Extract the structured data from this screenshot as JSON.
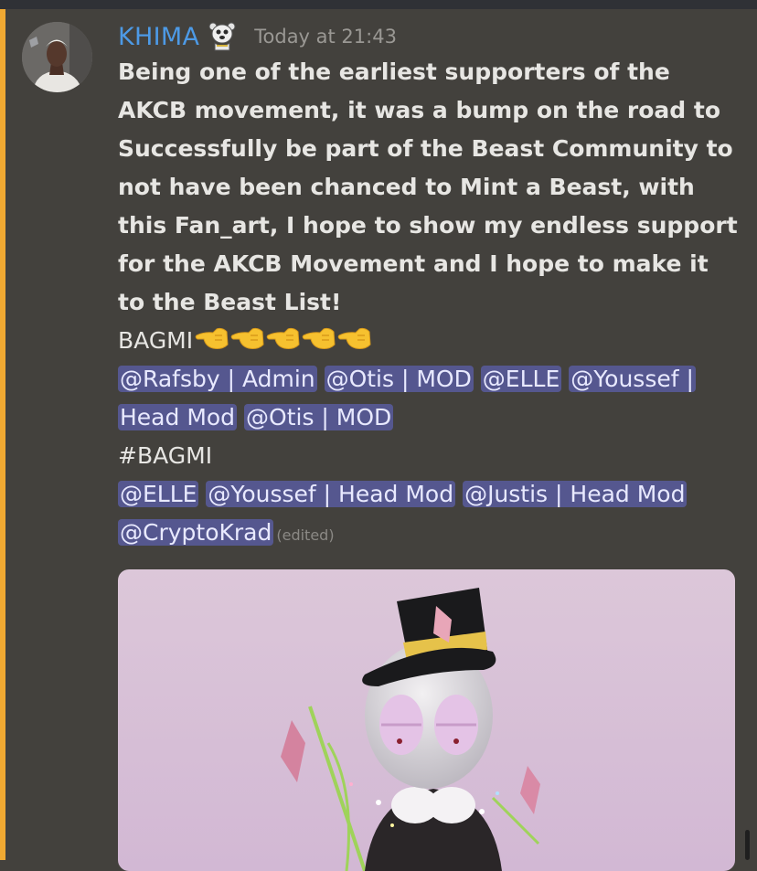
{
  "message": {
    "username": "KHIMA",
    "timestamp": "Today at 21:43",
    "body": "Being one of the earliest supporters of the\nAKCB movement, it was a bump on the road to\nSuccessfully be part of the Beast Community to\nnot have been chanced  to Mint a Beast, with\nthis Fan_art, I hope to show my endless support\nfor the AKCB Movement and I hope to make it\nto the Beast List!",
    "bagmi": "BAGMI",
    "mentions_1": [
      "@Rafsby | Admin",
      "@Otis | MOD",
      "@ELLE",
      "@Youssef | Head Mod",
      "@Otis | MOD"
    ],
    "hashtag": "#BAGMI",
    "mentions_2": [
      "@ELLE",
      "@Youssef | Head Mod",
      "@Justis | Head Mod",
      "@CryptoKrad"
    ],
    "edited": "(edited)"
  },
  "icons": {
    "badge": "bear-badge-icon",
    "emoji": "backhand-pointing-left-emoji-icon",
    "avatar": "user-avatar-photo"
  },
  "colors": {
    "background": "#43413d",
    "accent_bar": "#f0a932",
    "username": "#4d9ae6",
    "mention_bg": "#55578f",
    "timestamp": "#9a9894"
  }
}
